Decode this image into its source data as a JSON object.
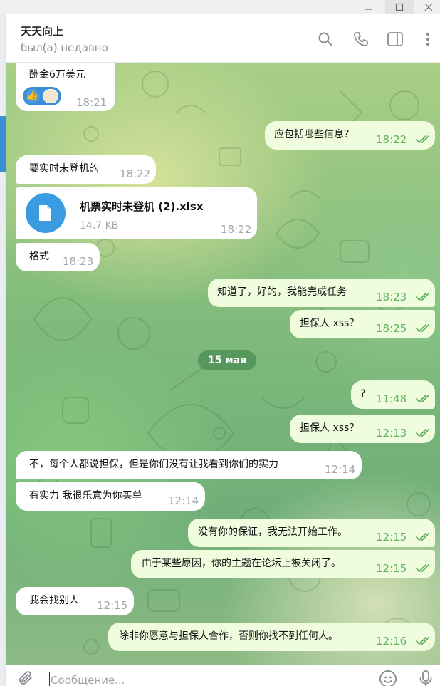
{
  "window": {
    "minimize_icon": "minimize-icon",
    "maximize_icon": "maximize-icon",
    "close_icon": "close-icon"
  },
  "header": {
    "title": "天天向上",
    "status": "был(а) недавно",
    "icons": [
      "search-icon",
      "phone-icon",
      "sidebar-toggle-icon",
      "more-vertical-icon"
    ]
  },
  "colors": {
    "incoming_bubble": "#ffffff",
    "outgoing_bubble": "#effdde",
    "outgoing_time": "#5fb25c",
    "accent": "#3a8fd6"
  },
  "messages": [
    {
      "dir": "in",
      "text": "酬金6万美元",
      "time": "18:21",
      "reactions": [
        "thumbs-up",
        "avatar-sticker"
      ]
    },
    {
      "dir": "out",
      "text": "应包括哪些信息？",
      "time": "18:22",
      "read": true
    },
    {
      "dir": "in",
      "text": "要实时未登机的",
      "time": "18:22"
    },
    {
      "dir": "in",
      "file_name": "机票实时未登机 (2).xlsx",
      "file_size": "14.7 KB",
      "time": "18:22",
      "icon": "file-icon"
    },
    {
      "dir": "in",
      "text": "格式",
      "time": "18:23"
    },
    {
      "dir": "out",
      "text": "知道了，好的，我能完成任务",
      "time": "18:23",
      "read": true
    },
    {
      "dir": "out",
      "text": "担保人 xss？",
      "time": "18:25",
      "read": true
    },
    {
      "dir": "out",
      "text": "?",
      "time": "11:48",
      "read": true
    },
    {
      "dir": "out",
      "text": "担保人 xss？",
      "time": "12:13",
      "read": true
    },
    {
      "dir": "in",
      "text": "不，每个人都说担保，但是你们没有让我看到你们的实力",
      "time": "12:14"
    },
    {
      "dir": "in",
      "text": "有实力 我很乐意为你买单",
      "time": "12:14"
    },
    {
      "dir": "out",
      "text": "没有你的保证，我无法开始工作。",
      "time": "12:15",
      "read": true
    },
    {
      "dir": "out",
      "text": "由于某些原因，你的主题在论坛上被关闭了。",
      "time": "12:15",
      "read": true
    },
    {
      "dir": "in",
      "text": "我会找别人",
      "time": "12:15"
    },
    {
      "dir": "out",
      "text": "除非你愿意与担保人合作，否则你找不到任何人。",
      "time": "12:16",
      "read": true
    }
  ],
  "date_separator": "15 мая",
  "composer": {
    "placeholder": "Сообщение...",
    "value": "",
    "icons": [
      "paperclip-icon",
      "emoji-icon",
      "microphone-icon"
    ]
  }
}
